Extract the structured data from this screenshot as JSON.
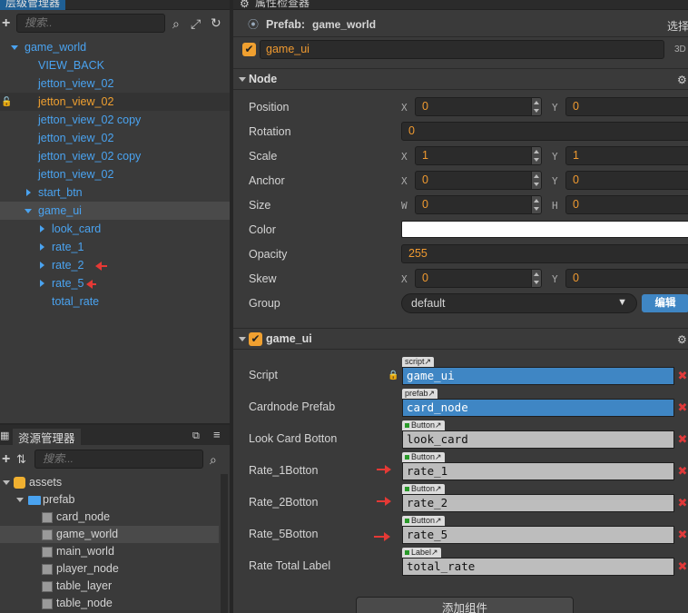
{
  "hierarchy": {
    "tab": "层级管理器",
    "search_placeholder": "搜索..",
    "items": [
      {
        "label": "game_world"
      },
      {
        "label": "VIEW_BACK"
      },
      {
        "label": "jetton_view_02"
      },
      {
        "label": "jetton_view_02"
      },
      {
        "label": "jetton_view_02 copy"
      },
      {
        "label": "jetton_view_02"
      },
      {
        "label": "jetton_view_02 copy"
      },
      {
        "label": "jetton_view_02"
      },
      {
        "label": "start_btn"
      },
      {
        "label": "game_ui"
      },
      {
        "label": "look_card"
      },
      {
        "label": "rate_1"
      },
      {
        "label": "rate_2"
      },
      {
        "label": "rate_5"
      },
      {
        "label": "total_rate"
      }
    ]
  },
  "assets": {
    "tab": "资源管理器",
    "search_placeholder": "搜索...",
    "items": [
      {
        "label": "assets"
      },
      {
        "label": "prefab"
      },
      {
        "label": "card_node"
      },
      {
        "label": "game_world"
      },
      {
        "label": "main_world"
      },
      {
        "label": "player_node"
      },
      {
        "label": "table_layer"
      },
      {
        "label": "table_node"
      }
    ]
  },
  "inspector": {
    "tab": "属性检查器",
    "prefab_label": "Prefab:",
    "prefab_name": "game_world",
    "select_label": "选择",
    "node_name": "game_ui",
    "badge_3d": "3D",
    "node_section": "Node",
    "props": {
      "position": {
        "label": "Position",
        "x": "0",
        "y": "0"
      },
      "rotation": {
        "label": "Rotation",
        "value": "0"
      },
      "scale": {
        "label": "Scale",
        "x": "1",
        "y": "1"
      },
      "anchor": {
        "label": "Anchor",
        "x": "0",
        "y": "0"
      },
      "size": {
        "label": "Size",
        "w": "0",
        "h": "0"
      },
      "color": {
        "label": "Color",
        "value": "#ffffff"
      },
      "opacity": {
        "label": "Opacity",
        "value": "255"
      },
      "skew": {
        "label": "Skew",
        "x": "0",
        "y": "0"
      },
      "group": {
        "label": "Group",
        "value": "default",
        "edit": "编辑"
      }
    },
    "axis": {
      "x": "X",
      "y": "Y",
      "w": "W",
      "h": "H"
    },
    "component_section": "game_ui",
    "component_fields": [
      {
        "label": "Script",
        "tag": "script",
        "value": "game_ui"
      },
      {
        "label": "Cardnode Prefab",
        "tag": "prefab",
        "value": "card_node"
      },
      {
        "label": "Look Card Botton",
        "tag": "Button",
        "value": "look_card"
      },
      {
        "label": "Rate_1Botton",
        "tag": "Button",
        "value": "rate_1"
      },
      {
        "label": "Rate_2Botton",
        "tag": "Button",
        "value": "rate_2"
      },
      {
        "label": "Rate_5Botton",
        "tag": "Button",
        "value": "rate_5"
      },
      {
        "label": "Rate Total Label",
        "tag": "Label",
        "value": "total_rate"
      }
    ],
    "add_component": "添加组件"
  },
  "colors": {
    "accent": "#4aa3f0",
    "highlight": "#f0a030",
    "arrow": "#e53935",
    "ref_blue": "#3f86c4"
  }
}
